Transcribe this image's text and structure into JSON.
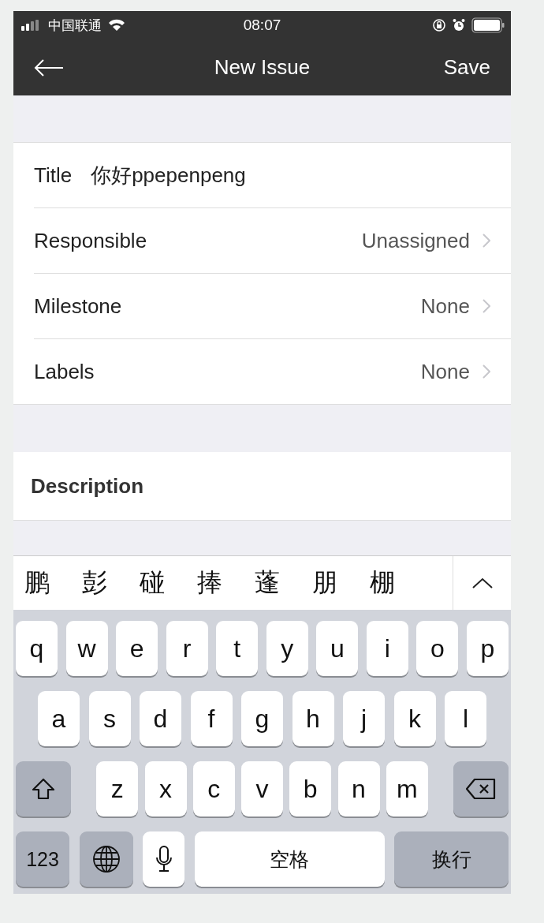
{
  "status_bar": {
    "carrier": "中国联通",
    "time": "08:07"
  },
  "nav": {
    "title": "New Issue",
    "action": "Save"
  },
  "form": [
    {
      "kind": "field",
      "label": "Title",
      "value": "你好ppepenpeng"
    },
    {
      "kind": "picker",
      "label": "Responsible",
      "value": "Unassigned"
    },
    {
      "kind": "picker",
      "label": "Milestone",
      "value": "None"
    },
    {
      "kind": "picker",
      "label": "Labels",
      "value": "None"
    }
  ],
  "description": {
    "label": "Description"
  },
  "candidates": [
    "鹏",
    "彭",
    "碰",
    "捧",
    "蓬",
    "朋",
    "棚"
  ],
  "keyboard": [
    [
      {
        "kind": "letter",
        "label": "q"
      },
      {
        "kind": "letter",
        "label": "w"
      },
      {
        "kind": "letter",
        "label": "e"
      },
      {
        "kind": "letter",
        "label": "r"
      },
      {
        "kind": "letter",
        "label": "t"
      },
      {
        "kind": "letter",
        "label": "y"
      },
      {
        "kind": "letter",
        "label": "u"
      },
      {
        "kind": "letter",
        "label": "i"
      },
      {
        "kind": "letter",
        "label": "o"
      },
      {
        "kind": "letter",
        "label": "p"
      }
    ],
    [
      {
        "kind": "letter",
        "label": "a"
      },
      {
        "kind": "letter",
        "label": "s"
      },
      {
        "kind": "letter",
        "label": "d"
      },
      {
        "kind": "letter",
        "label": "f"
      },
      {
        "kind": "letter",
        "label": "g"
      },
      {
        "kind": "letter",
        "label": "h"
      },
      {
        "kind": "letter",
        "label": "j"
      },
      {
        "kind": "letter",
        "label": "k"
      },
      {
        "kind": "letter",
        "label": "l"
      }
    ],
    [
      {
        "kind": "shift"
      },
      {
        "kind": "letter",
        "label": "z"
      },
      {
        "kind": "letter",
        "label": "x"
      },
      {
        "kind": "letter",
        "label": "c"
      },
      {
        "kind": "letter",
        "label": "v"
      },
      {
        "kind": "letter",
        "label": "b"
      },
      {
        "kind": "letter",
        "label": "n"
      },
      {
        "kind": "letter",
        "label": "m"
      },
      {
        "kind": "delete"
      }
    ],
    [
      {
        "kind": "numbers",
        "label": "123"
      },
      {
        "kind": "globe"
      },
      {
        "kind": "mic"
      },
      {
        "kind": "space",
        "label": "空格"
      },
      {
        "kind": "return",
        "label": "换行"
      }
    ]
  ]
}
